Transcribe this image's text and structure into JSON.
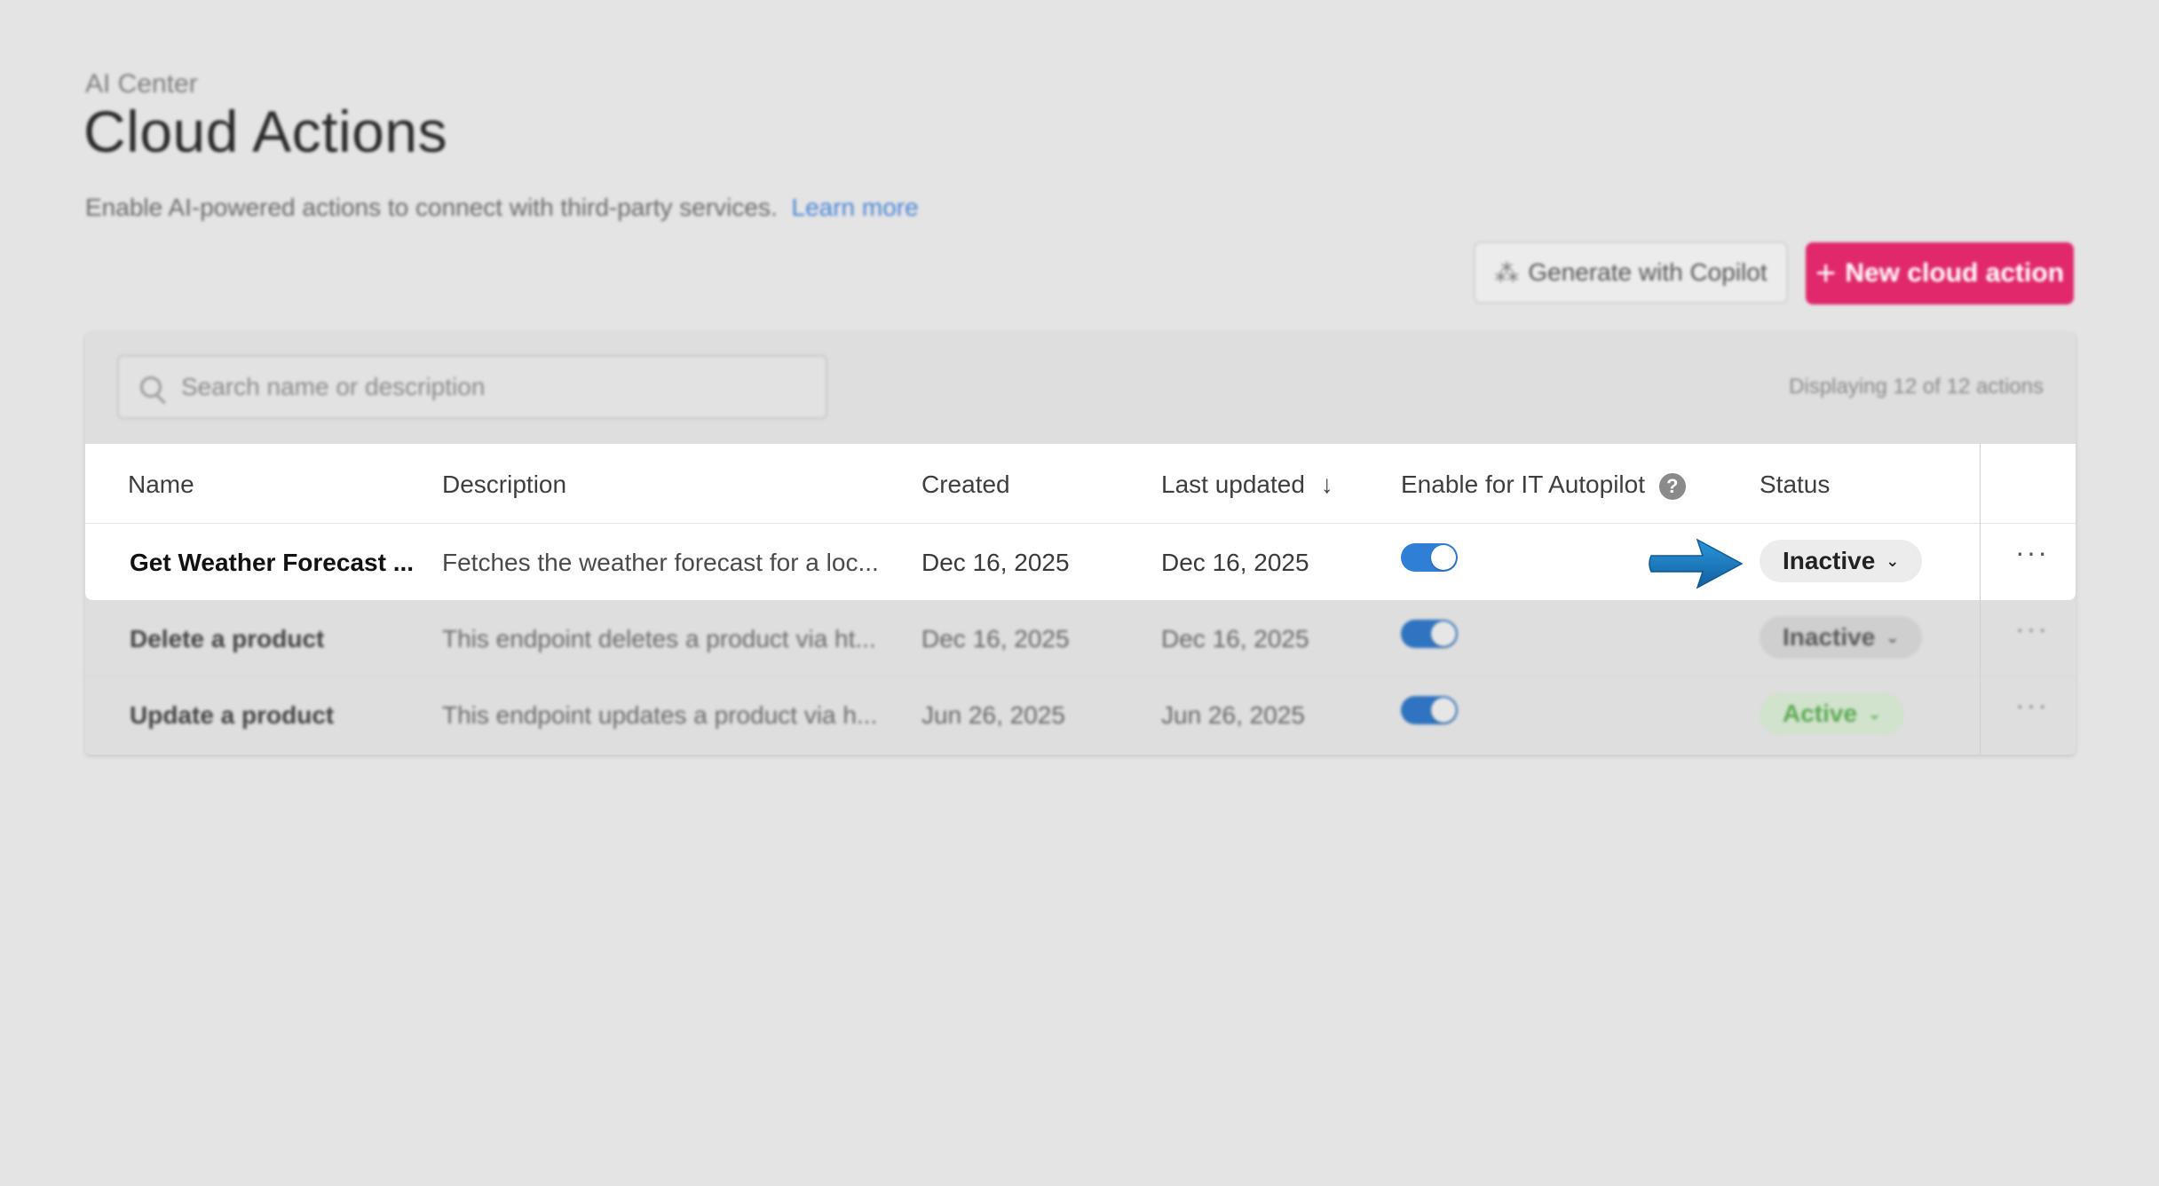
{
  "header": {
    "breadcrumb": "AI Center",
    "title": "Cloud Actions",
    "subtitle": "Enable AI-powered actions to connect with third-party services.",
    "learn_more": "Learn more"
  },
  "toolbar": {
    "copilot_label": "Generate with Copilot",
    "new_label": "New cloud action"
  },
  "search": {
    "placeholder": "Search name or description"
  },
  "count_text": "Displaying 12 of 12 actions",
  "columns": {
    "name": "Name",
    "description": "Description",
    "created": "Created",
    "updated": "Last updated",
    "autopilot": "Enable for IT Autopilot",
    "status": "Status"
  },
  "rows": [
    {
      "name": "Get Weather Forecast ...",
      "description": "Fetches the weather forecast for a loc...",
      "created": "Dec 16, 2025",
      "updated": "Dec 16, 2025",
      "enabled": true,
      "status": "Inactive"
    },
    {
      "name": "Delete a product",
      "description": "This endpoint deletes a product via ht...",
      "created": "Dec 16, 2025",
      "updated": "Dec 16, 2025",
      "enabled": true,
      "status": "Inactive"
    },
    {
      "name": "Update a product",
      "description": "This endpoint updates a product via h...",
      "created": "Jun 26, 2025",
      "updated": "Jun 26, 2025",
      "enabled": true,
      "status": "Active"
    }
  ],
  "colors": {
    "accent": "#e0286b",
    "toggle": "#2f7fd6",
    "link": "#4a86d8",
    "arrow": "#1f7fc4"
  }
}
